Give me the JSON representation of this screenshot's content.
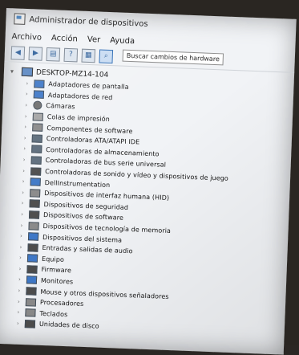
{
  "window": {
    "title": "Administrador de dispositivos"
  },
  "menu": [
    "Archivo",
    "Acción",
    "Ver",
    "Ayuda"
  ],
  "toolbar": {
    "tooltip": "Buscar cambios de hardware",
    "buttons": [
      "back-icon",
      "forward-icon",
      "properties-icon",
      "help-icon",
      "device-view-icon",
      "scan-hardware-icon"
    ]
  },
  "tree": {
    "root": "DESKTOP-MZ14-104",
    "categories": [
      "Adaptadores de pantalla",
      "Adaptadores de red",
      "Cámaras",
      "Colas de impresión",
      "Componentes de software",
      "Controladoras ATA/ATAPI IDE",
      "Controladoras de almacenamiento",
      "Controladoras de bus serie universal",
      "Controladoras de sonido y vídeo y dispositivos de juego",
      "DellInstrumentation",
      "Dispositivos de interfaz humana (HID)",
      "Dispositivos de seguridad",
      "Dispositivos de software",
      "Dispositivos de tecnología de memoria",
      "Dispositivos del sistema",
      "Entradas y salidas de audio",
      "Equipo",
      "Firmware",
      "Monitores",
      "Mouse y otros dispositivos señaladores",
      "Procesadores",
      "Teclados",
      "Unidades de disco"
    ]
  },
  "colors": {
    "accent": "#2f6db4",
    "background": "#f1f3f6"
  }
}
